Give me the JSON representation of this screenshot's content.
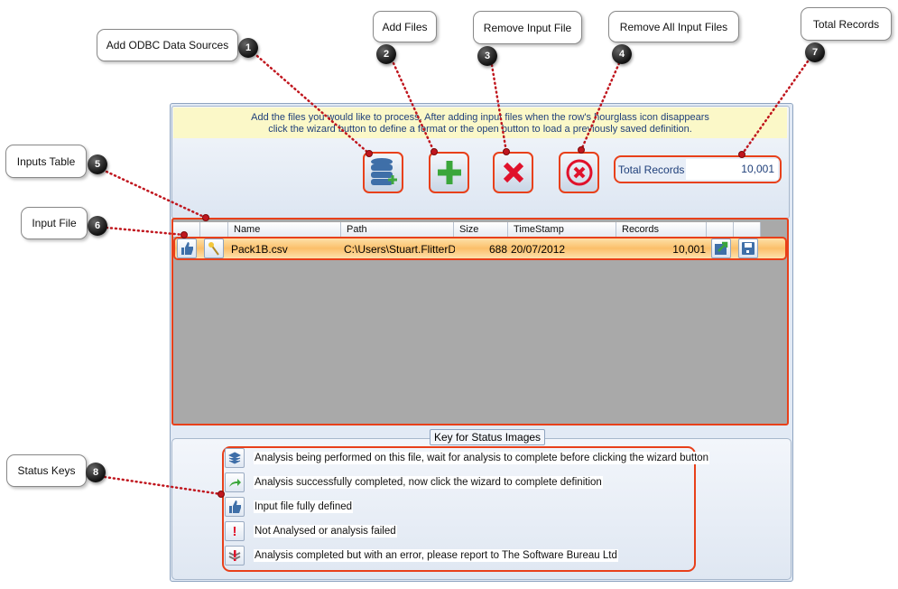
{
  "callouts": [
    {
      "n": "1",
      "label": "Add ODBC Data Sources"
    },
    {
      "n": "2",
      "label": "Add Files"
    },
    {
      "n": "3",
      "label": "Remove Input File"
    },
    {
      "n": "4",
      "label": "Remove All Input Files"
    },
    {
      "n": "5",
      "label": "Inputs Table"
    },
    {
      "n": "6",
      "label": "Input File"
    },
    {
      "n": "7",
      "label": "Total Records"
    },
    {
      "n": "8",
      "label": "Status Keys"
    }
  ],
  "banner": {
    "line1": "Add the files you would like to process.  After adding input files when the row's hourglass icon disappears",
    "line2": "click the wizard button to define a format or the open button to load a previously saved definition."
  },
  "toolbar": {
    "add_odbc_icon": "database-add-icon",
    "add_files_icon": "plus-icon",
    "remove_icon": "x-icon",
    "remove_all_icon": "circle-x-icon"
  },
  "total_records": {
    "label": "Total Records",
    "value": "10,001"
  },
  "table": {
    "columns": [
      "",
      "",
      "Name",
      "Path",
      "Size",
      "TimeStamp",
      "Records",
      "",
      ""
    ],
    "rows": [
      {
        "status_icon": "thumbs-up-icon",
        "wizard_icon": "wand-icon",
        "name": "Pack1B.csv",
        "path": "C:\\Users\\Stuart.FlitterD...",
        "size": "688",
        "timestamp": "20/07/2012",
        "records": "10,001"
      }
    ]
  },
  "key": {
    "title": "Key for Status Images",
    "items": [
      {
        "icon": "layers-icon",
        "text": "Analysis being performed on this file, wait for analysis to complete before clicking the wizard button"
      },
      {
        "icon": "arrow-right-icon",
        "text": "Analysis successfully completed, now click the wizard to complete definition"
      },
      {
        "icon": "thumbs-up-icon",
        "text": "Input file fully defined"
      },
      {
        "icon": "exclamation-icon",
        "text": "Not Analysed or analysis failed"
      },
      {
        "icon": "error-icon",
        "text": "Analysis completed but with an error, please report to The Software Bureau Ltd"
      }
    ]
  },
  "colors": {
    "highlight": "#e8401a",
    "accent_dot": "#c0161e",
    "banner": "#fbf8c8"
  }
}
